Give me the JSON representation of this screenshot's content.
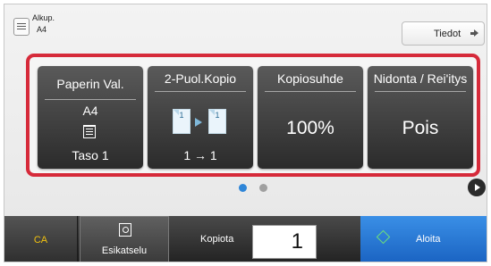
{
  "original": {
    "label": "Alkup.",
    "size": "A4"
  },
  "details_button": {
    "label": "Tiedot"
  },
  "tiles": {
    "paper": {
      "title": "Paperin Val.",
      "size": "A4",
      "tray": "Taso 1"
    },
    "duplex": {
      "title": "2-Puol.Kopio",
      "page_num": "1",
      "value": "1 → 1"
    },
    "ratio": {
      "title": "Kopiosuhde",
      "value": "100%"
    },
    "finishing": {
      "title": "Nidonta / Rei'itys",
      "value": "Pois"
    }
  },
  "pager": {
    "active_page": 1,
    "total_pages": 2
  },
  "bottom": {
    "ca_label": "CA",
    "preview_label": "Esikatselu",
    "copies_label": "Kopiota",
    "copies_value": "1",
    "start_label": "Aloita"
  },
  "colors": {
    "highlight_border": "#d62a3a",
    "ca_text": "#f2c20f",
    "start_button": "#2a7ad6",
    "pager_active": "#2f86d8"
  },
  "icons": [
    "original-icon",
    "arrow-right-icon",
    "tray-icon",
    "duplex-icon",
    "preview-icon",
    "start-icon",
    "next-page-icon"
  ]
}
